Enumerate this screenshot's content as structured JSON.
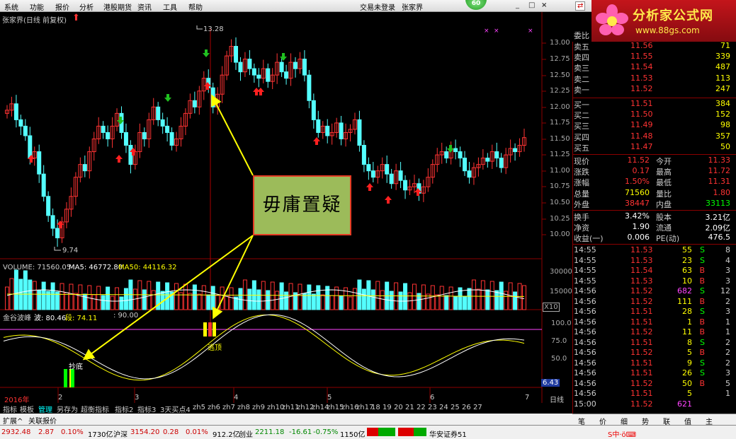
{
  "menu": [
    "系统",
    "功能",
    "报价",
    "分析",
    "港股期货",
    "资讯",
    "工具",
    "帮助"
  ],
  "status": {
    "login": "交易未登录",
    "stock": "张家界",
    "badge": "60"
  },
  "logo": {
    "main": "分析家公式网",
    "sub": "www.88gs.com"
  },
  "chart": {
    "title": "张家界(日线 前复权)",
    "price_ticks": [
      "13.00",
      "12.75",
      "12.50",
      "12.25",
      "12.00",
      "11.75",
      "11.50",
      "11.25",
      "11.00",
      "10.75",
      "10.50",
      "10.25",
      "10.00"
    ],
    "high_label": "13.28",
    "low_label": "9.74",
    "volume_header": {
      "vol": "VOLUME: 71560.05",
      "ma5": "MA5: 46772.80",
      "ma50": "MA50: 44116.32"
    },
    "volume_ticks": [
      "30000",
      "15000"
    ],
    "volume_unit": "X10",
    "osc_header": {
      "name": "金谷波峰",
      "wave": "波: 80.46",
      "seg": "段: 74.11",
      "line": ": 90.00"
    },
    "osc_ticks": [
      "100.0",
      "75.0",
      "50.0"
    ],
    "osc_value": "6.43",
    "buy_label": "抄底",
    "sell_label": "逃顶",
    "callout": "毋庸置疑",
    "date_axis": [
      "2016年",
      "2",
      "3",
      "4",
      "5",
      "6",
      "7"
    ],
    "period": "日线"
  },
  "quote": {
    "header": "委比",
    "asks": [
      {
        "label": "卖五",
        "price": "11.56",
        "vol": "71"
      },
      {
        "label": "卖四",
        "price": "11.55",
        "vol": "339"
      },
      {
        "label": "卖三",
        "price": "11.54",
        "vol": "487"
      },
      {
        "label": "卖二",
        "price": "11.53",
        "vol": "113"
      },
      {
        "label": "卖一",
        "price": "11.52",
        "vol": "247"
      }
    ],
    "bids": [
      {
        "label": "买一",
        "price": "11.51",
        "vol": "384"
      },
      {
        "label": "买二",
        "price": "11.50",
        "vol": "152"
      },
      {
        "label": "买三",
        "price": "11.49",
        "vol": "98"
      },
      {
        "label": "买四",
        "price": "11.48",
        "vol": "357"
      },
      {
        "label": "买五",
        "price": "11.47",
        "vol": "50"
      }
    ],
    "stats": [
      {
        "l1": "现价",
        "v1": "11.52",
        "l2": "今开",
        "v2": "11.33"
      },
      {
        "l1": "涨跌",
        "v1": "0.17",
        "l2": "最高",
        "v2": "11.72"
      },
      {
        "l1": "涨幅",
        "v1": "1.50%",
        "l2": "最低",
        "v2": "11.31"
      },
      {
        "l1": "总量",
        "v1": "71560",
        "l2": "量比",
        "v2": "1.80"
      },
      {
        "l1": "外盘",
        "v1": "38447",
        "l2": "内盘",
        "v2": "33113"
      }
    ],
    "stats2": [
      {
        "l1": "换手",
        "v1": "3.42%",
        "l2": "股本",
        "v2": "3.21亿"
      },
      {
        "l1": "净资",
        "v1": "1.90",
        "l2": "流通",
        "v2": "2.09亿"
      },
      {
        "l1": "收益(一)",
        "v1": "0.006",
        "l2": "PE(动)",
        "v2": "476.5"
      }
    ],
    "ticks": [
      [
        "14:55",
        "11.53",
        "55",
        "S",
        "8"
      ],
      [
        "14:55",
        "11.53",
        "23",
        "S",
        "4"
      ],
      [
        "14:55",
        "11.54",
        "63",
        "B",
        "3"
      ],
      [
        "14:55",
        "11.53",
        "10",
        "B",
        "3"
      ],
      [
        "14:56",
        "11.52",
        "682",
        "S",
        "12"
      ],
      [
        "14:56",
        "11.52",
        "111",
        "B",
        "2"
      ],
      [
        "14:56",
        "11.51",
        "28",
        "S",
        "3"
      ],
      [
        "14:56",
        "11.51",
        "1",
        "B",
        "1"
      ],
      [
        "14:56",
        "11.52",
        "11",
        "B",
        "1"
      ],
      [
        "14:56",
        "11.51",
        "8",
        "S",
        "2"
      ],
      [
        "14:56",
        "11.52",
        "5",
        "B",
        "2"
      ],
      [
        "14:56",
        "11.51",
        "9",
        "S",
        "2"
      ],
      [
        "14:56",
        "11.51",
        "26",
        "S",
        "3"
      ],
      [
        "14:56",
        "11.52",
        "50",
        "B",
        "5"
      ],
      [
        "14:56",
        "11.51",
        "5",
        "",
        "1"
      ],
      [
        "15:00",
        "11.52",
        "621",
        "",
        ""
      ]
    ]
  },
  "tabs": [
    "指标",
    "模板",
    "管理",
    "另存为",
    "超衡指标",
    "指标2",
    "指标3",
    "3天买点4",
    "zh5",
    "zh6",
    "zh7",
    "zh8",
    "zh9",
    "zh10",
    "zh11",
    "zh12",
    "zh14",
    "zh15",
    "zh16",
    "zh17",
    "18",
    "19",
    "20",
    "21",
    "22",
    "23",
    "24",
    "25",
    "26",
    "27"
  ],
  "subbar": [
    "扩展^",
    "关联报价"
  ],
  "side_buttons": [
    "笔",
    "价",
    "细",
    "势",
    "联",
    "值",
    "主"
  ],
  "statusbar": {
    "sh": "2932.48",
    "sh_chg": "2.87",
    "sh_pct": "0.10%",
    "sh_amt": "1730亿",
    "hs_label": "沪深",
    "hs": "3154.20",
    "hs_chg": "0.28",
    "hs_pct": "0.01%",
    "hs_amt": "912.2亿",
    "cy_label": "创业",
    "cy": "2211.18",
    "cy_chg": "-16.61",
    "cy_pct": "-0.75%",
    "cy_amt": "1150亿",
    "broker": "华安证券51"
  },
  "colors": {
    "up": "#ff3333",
    "down": "#54ffff",
    "ma": "#ffff00",
    "grid": "#8b0000"
  }
}
